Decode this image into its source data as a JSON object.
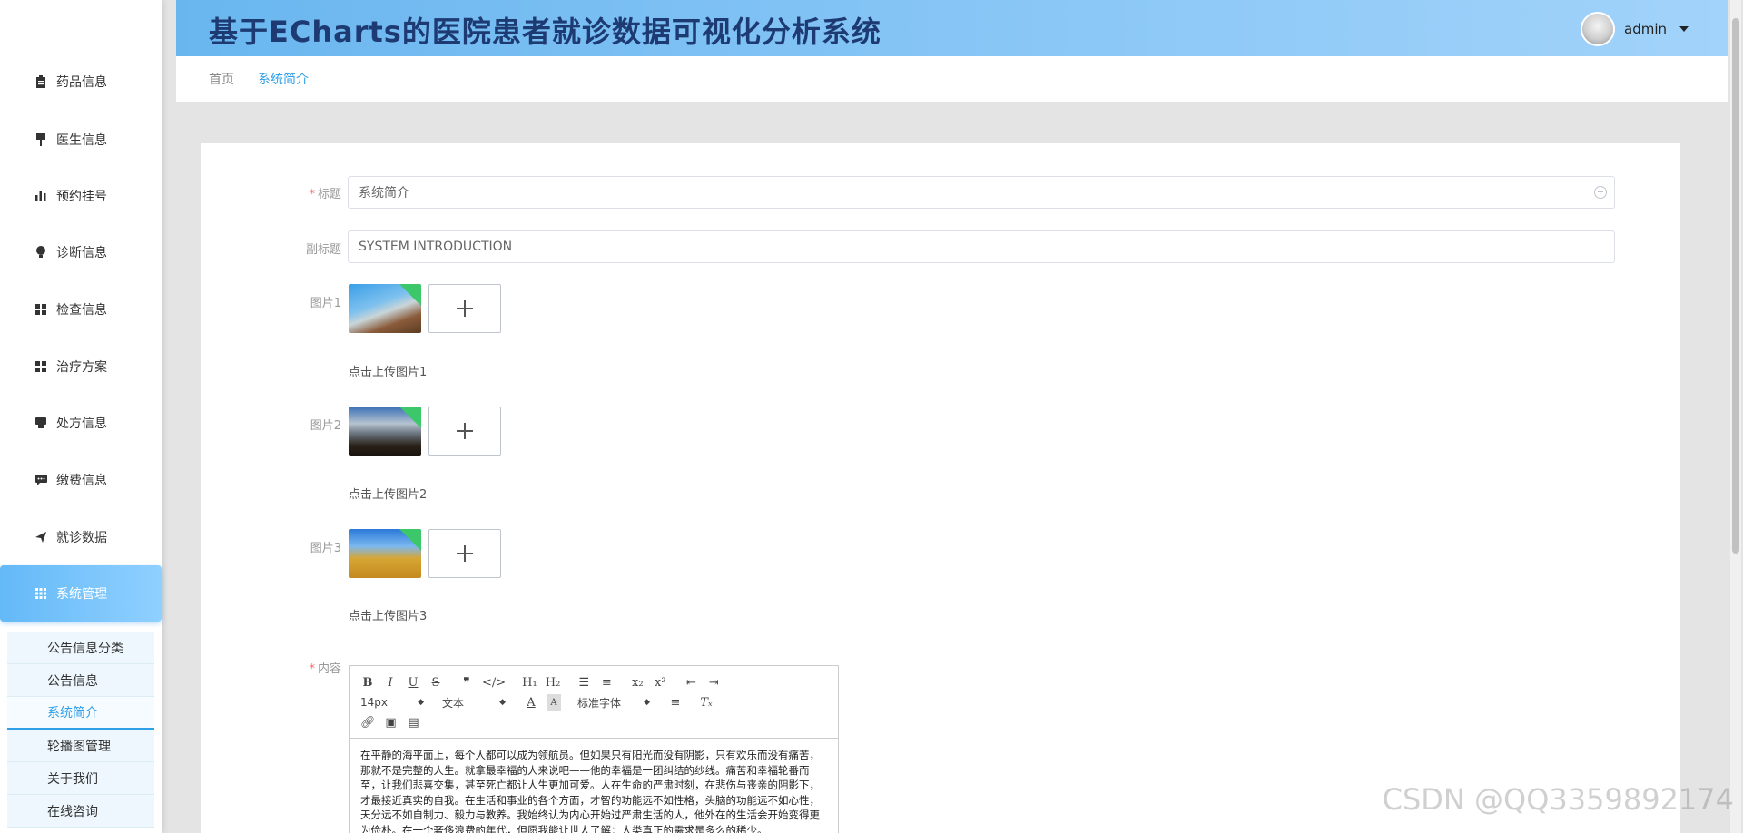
{
  "header": {
    "title": "基于ECharts的医院患者就诊数据可视化分析系统",
    "username": "admin"
  },
  "sidebar": {
    "items": [
      {
        "label": "药品信息",
        "icon": "clipboard-icon"
      },
      {
        "label": "医生信息",
        "icon": "pin-icon"
      },
      {
        "label": "预约挂号",
        "icon": "bar-chart-icon"
      },
      {
        "label": "诊断信息",
        "icon": "bulb-icon"
      },
      {
        "label": "检查信息",
        "icon": "grid-icon"
      },
      {
        "label": "治疗方案",
        "icon": "grid-icon"
      },
      {
        "label": "处方信息",
        "icon": "printer-icon"
      },
      {
        "label": "缴费信息",
        "icon": "chat-icon"
      },
      {
        "label": "就诊数据",
        "icon": "send-icon"
      },
      {
        "label": "系统管理",
        "icon": "apps-icon"
      }
    ],
    "submenu": [
      "公告信息分类",
      "公告信息",
      "系统简介",
      "轮播图管理",
      "关于我们",
      "在线咨询"
    ]
  },
  "breadcrumb": {
    "home": "首页",
    "current": "系统简介"
  },
  "form": {
    "title_label": "标题",
    "title_value": "系统简介",
    "subtitle_label": "副标题",
    "subtitle_value": "SYSTEM INTRODUCTION",
    "image1_label": "图片1",
    "image1_tip": "点击上传图片1",
    "image2_label": "图片2",
    "image2_tip": "点击上传图片2",
    "image3_label": "图片3",
    "image3_tip": "点击上传图片3",
    "content_label": "内容"
  },
  "editor": {
    "font_size": "14px",
    "text_type": "文本",
    "font_family": "标准字体",
    "content": "在平静的海平面上，每个人都可以成为领航员。但如果只有阳光而没有阴影，只有欢乐而没有痛苦，那就不是完整的人生。就拿最幸福的人来说吧——他的幸福是一团纠结的纱线。痛苦和幸福轮番而至，让我们悲喜交集，甚至死亡都让人生更加可爱。人在生命的严肃时刻，在悲伤与丧亲的阴影下，才最接近真实的自我。在生活和事业的各个方面，才智的功能远不如性格，头脑的功能远不如心性，天分远不如自制力、毅力与教养。我始终认为内心开始过严肃生活的人，他外在的生活会开始变得更为俭朴。在一个奢侈浪费的年代，但愿我能让世人了解：人类真正的需求是多么的稀少。"
  },
  "watermark": "CSDN @QQ3359892174"
}
